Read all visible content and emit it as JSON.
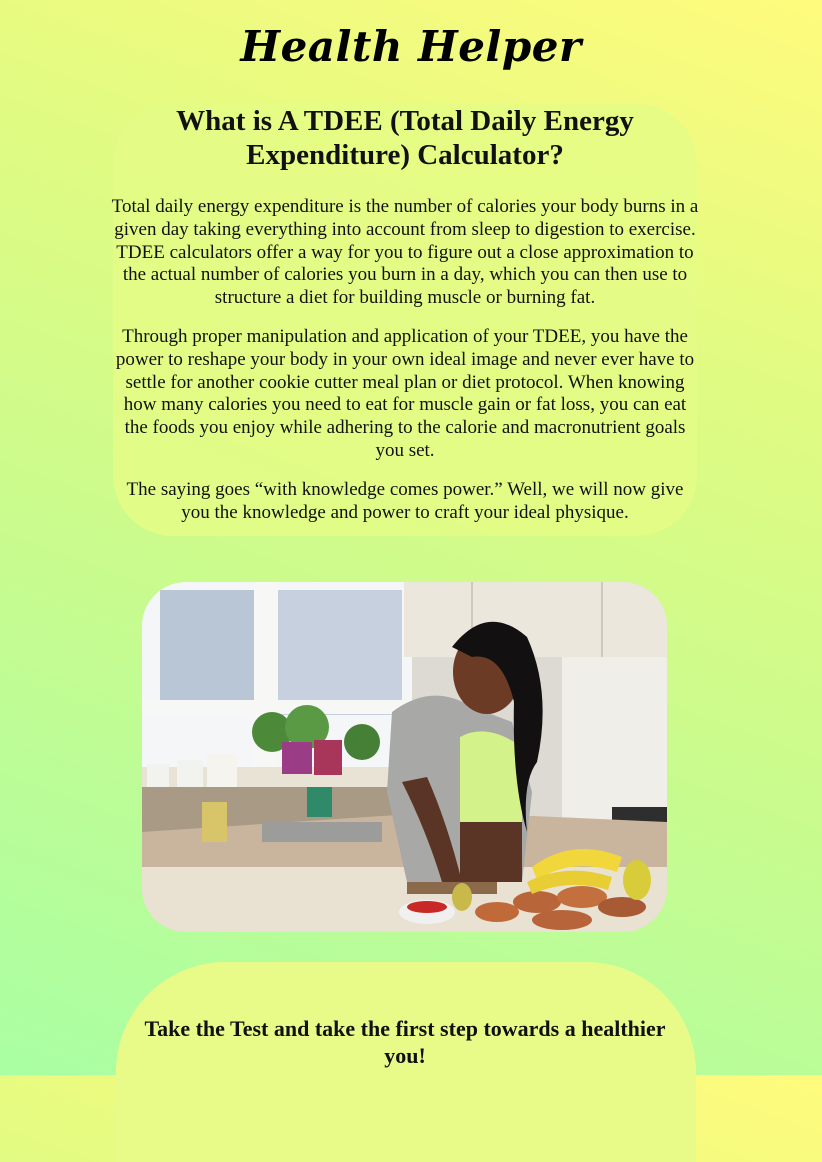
{
  "header": {
    "logo_text": "Health Helper"
  },
  "intro": {
    "heading": "What is A TDEE (Total Daily Energy Expenditure) Calculator?",
    "paragraphs": [
      "Total daily energy expenditure is the number of calories your body burns in a given day taking everything into account from sleep to digestion to exercise. TDEE calculators offer a way for you to figure out a close approximation to the actual number of calories you burn in a day, which you can then use to structure a diet for building muscle or burning fat.",
      "Through proper manipulation and application of your TDEE, you have the power to reshape your body in your own ideal image and never ever have to settle for another cookie cutter meal plan or diet protocol. When knowing how many calories you need to eat for muscle gain or fat loss, you can eat the foods you enjoy while adhering to the calorie and macronutrient goals you set.",
      "The saying goes “with knowledge comes power.” Well, we will now give you the knowledge and power to craft your ideal physique."
    ]
  },
  "hero_image": {
    "subject": "woman-preparing-food-in-kitchen"
  },
  "cta": {
    "text": "Take the Test and take the first step towards a healthier you!"
  }
}
